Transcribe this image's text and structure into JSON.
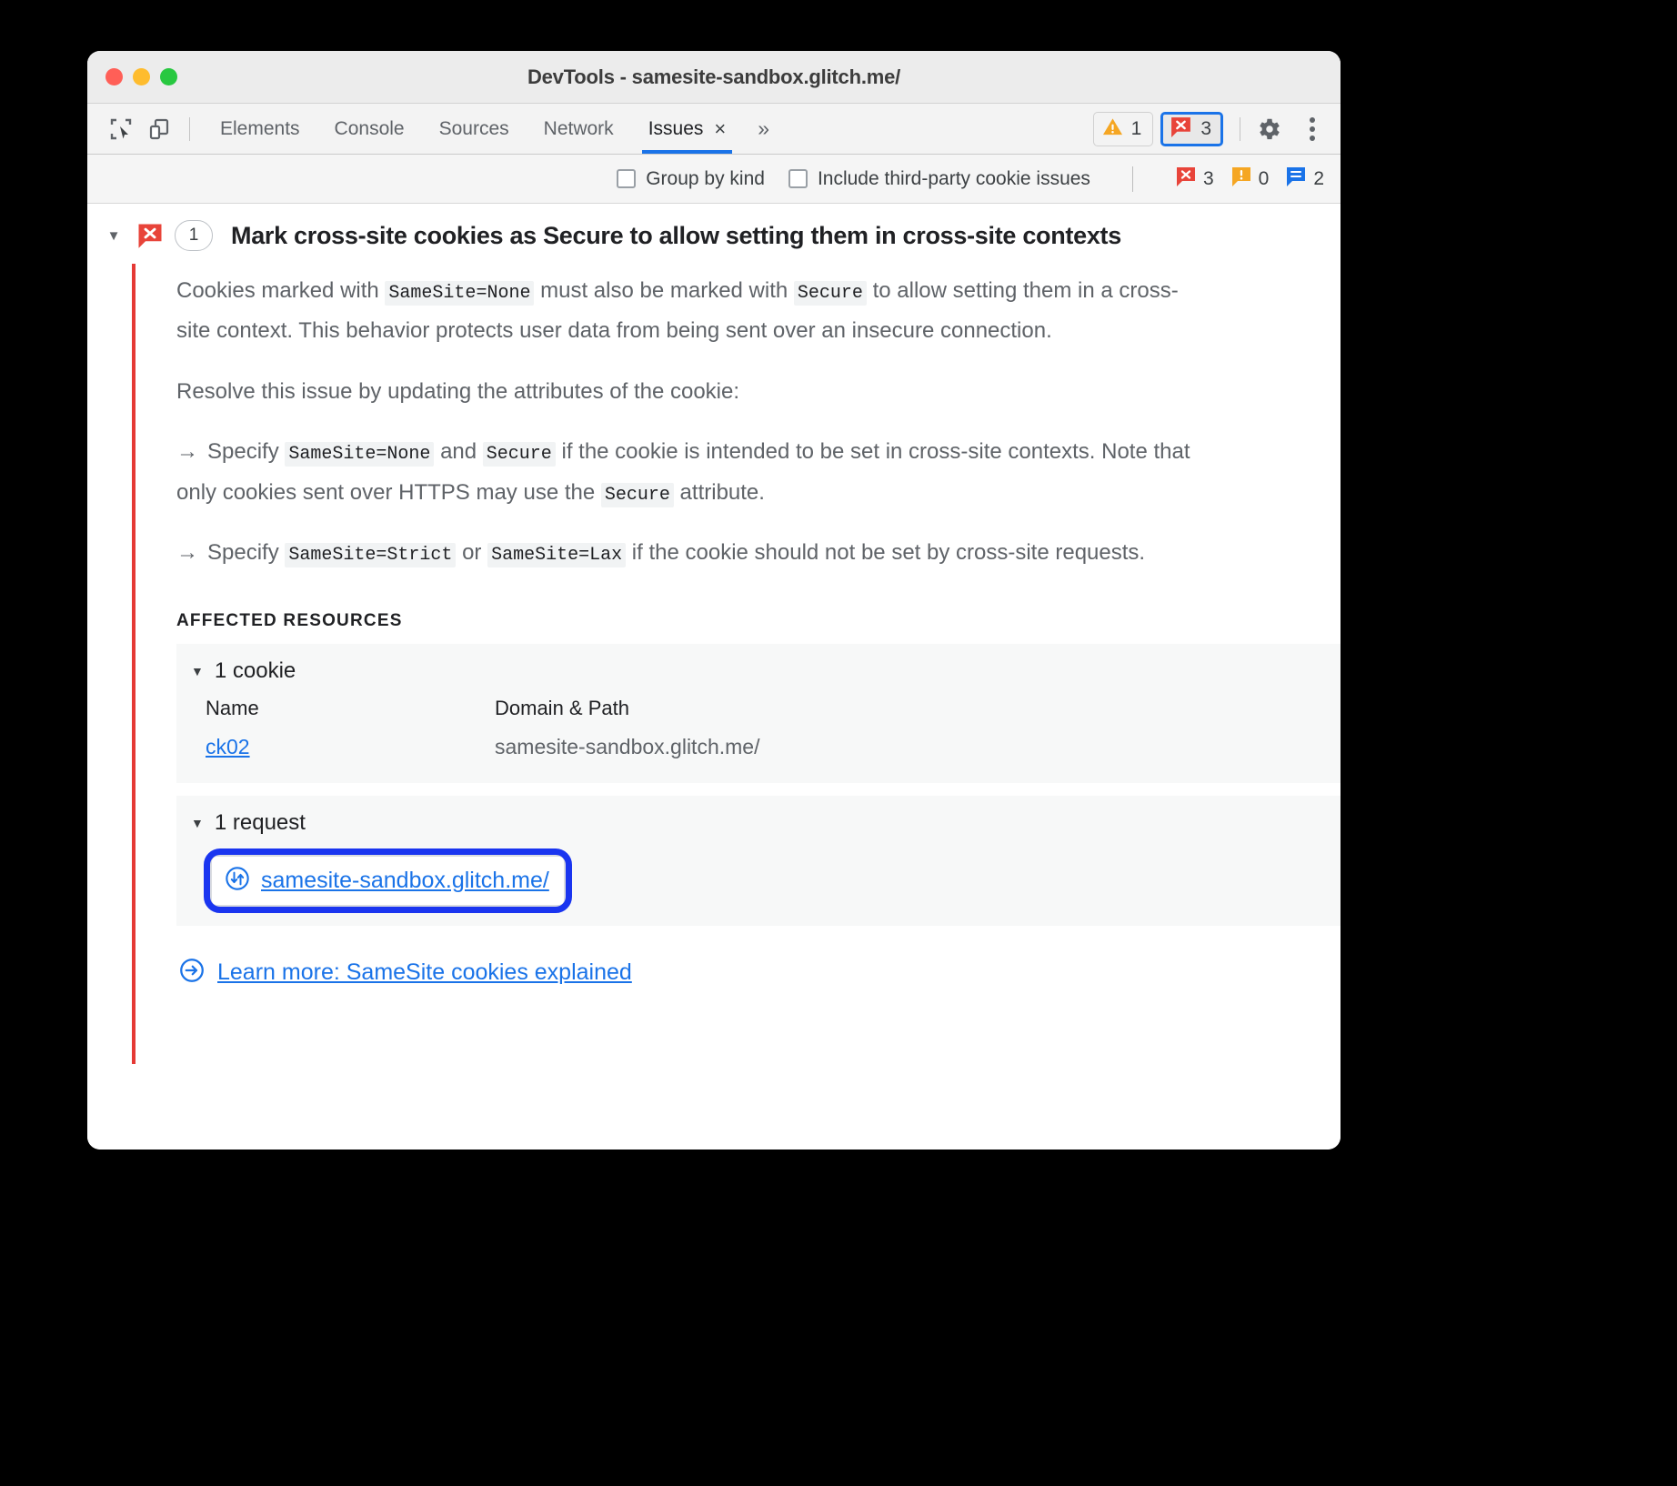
{
  "window": {
    "title": "DevTools - samesite-sandbox.glitch.me/",
    "traffic_lights": [
      "close",
      "minimize",
      "zoom"
    ]
  },
  "toolbar": {
    "left_icons": [
      {
        "name": "inspect-element-icon",
        "label": "Inspect element"
      },
      {
        "name": "device-toolbar-icon",
        "label": "Toggle device toolbar"
      }
    ],
    "tabs": [
      {
        "label": "Elements",
        "active": false
      },
      {
        "label": "Console",
        "active": false
      },
      {
        "label": "Sources",
        "active": false
      },
      {
        "label": "Network",
        "active": false
      },
      {
        "label": "Issues",
        "active": true,
        "closable": true
      }
    ],
    "tab_close_glyph": "×",
    "more_tabs_glyph": "»",
    "warning_badge": {
      "icon": "warning-triangle-icon",
      "count": "1"
    },
    "error_badge": {
      "icon": "error-bubble-icon",
      "count": "3",
      "focused": true
    },
    "settings_icon": "gear-icon",
    "menu_icon": "kebab-menu-icon"
  },
  "filterbar": {
    "checkboxes": [
      {
        "label": "Group by kind",
        "checked": false
      },
      {
        "label": "Include third-party cookie issues",
        "checked": false
      }
    ],
    "counters": [
      {
        "icon": "error-bubble-icon",
        "count": "3",
        "color": "#e8443a"
      },
      {
        "icon": "warning-bubble-icon",
        "count": "0",
        "color": "#f5a623"
      },
      {
        "icon": "info-bubble-icon",
        "count": "2",
        "color": "#1a73e8"
      }
    ]
  },
  "issue": {
    "caret_glyph": "▼",
    "severity_icon": "error-bubble-icon",
    "count": "1",
    "title": "Mark cross-site cookies as Secure to allow setting them in cross-site contexts",
    "accent_color": "#e53935",
    "paragraph1": {
      "p1": "Cookies marked with ",
      "code1": "SameSite=None",
      "p2": " must also be marked with ",
      "code2": "Secure",
      "p3": " to allow setting them in a cross-site context. This behavior protects user data from being sent over an insecure connection."
    },
    "paragraph2": "Resolve this issue by updating the attributes of the cookie:",
    "arrow_glyph": "→",
    "bullet1": {
      "p1": "Specify ",
      "code1": "SameSite=None",
      "p2": " and ",
      "code2": "Secure",
      "p3": " if the cookie is intended to be set in cross-site contexts. Note that only cookies sent over HTTPS may use the ",
      "code3": "Secure",
      "p4": " attribute."
    },
    "bullet2": {
      "p1": "Specify ",
      "code1": "SameSite=Strict",
      "p2": " or ",
      "code2": "SameSite=Lax",
      "p3": " if the cookie should not be set by cross-site requests."
    },
    "affected_resources_label": "AFFECTED RESOURCES",
    "cookie_section": {
      "caret_glyph": "▼",
      "title": "1 cookie",
      "columns": [
        "Name",
        "Domain & Path"
      ],
      "rows": [
        {
          "name": "ck02",
          "domain_path": "samesite-sandbox.glitch.me/"
        }
      ]
    },
    "request_section": {
      "caret_glyph": "▼",
      "title": "1 request",
      "request_icon": "request-arrows-icon",
      "url": "samesite-sandbox.glitch.me/",
      "highlighted": true,
      "highlight_color": "#1a35f0"
    },
    "learn_more": {
      "icon": "circle-arrow-right-icon",
      "text": "Learn more: SameSite cookies explained"
    }
  }
}
